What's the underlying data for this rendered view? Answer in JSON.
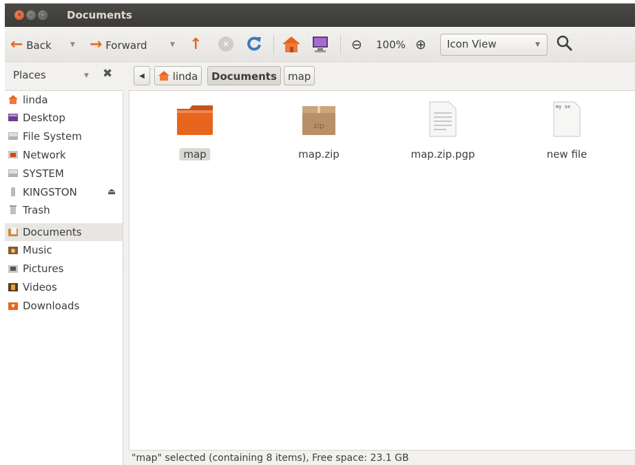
{
  "window": {
    "title": "Documents"
  },
  "toolbar": {
    "back_label": "Back",
    "forward_label": "Forward",
    "zoom_level": "100%",
    "view_mode": "Icon View"
  },
  "places": {
    "label": "Places"
  },
  "breadcrumb": [
    {
      "label": "linda"
    },
    {
      "label": "Documents"
    },
    {
      "label": "map"
    }
  ],
  "sidebar": {
    "items": [
      {
        "label": "linda",
        "icon": "home-folder-icon"
      },
      {
        "label": "Desktop",
        "icon": "desktop-icon"
      },
      {
        "label": "File System",
        "icon": "drive-icon"
      },
      {
        "label": "Network",
        "icon": "network-icon"
      },
      {
        "label": "SYSTEM",
        "icon": "drive-icon"
      },
      {
        "label": "KINGSTON",
        "icon": "usb-drive-icon"
      },
      {
        "label": "Trash",
        "icon": "trash-icon"
      },
      {
        "label": "Documents",
        "icon": "documents-folder-icon"
      },
      {
        "label": "Music",
        "icon": "music-folder-icon"
      },
      {
        "label": "Pictures",
        "icon": "pictures-folder-icon"
      },
      {
        "label": "Videos",
        "icon": "videos-folder-icon"
      },
      {
        "label": "Downloads",
        "icon": "downloads-folder-icon"
      }
    ]
  },
  "files": [
    {
      "name": "map",
      "icon": "folder-icon",
      "selected": true
    },
    {
      "name": "map.zip",
      "icon": "archive-icon"
    },
    {
      "name": "map.zip.pgp",
      "icon": "text-file-icon"
    },
    {
      "name": "new file",
      "icon": "text-file-icon",
      "thumb_text": "my se"
    }
  ],
  "status": {
    "text": "\"map\" selected (containing 8 items), Free space: 23.1 GB"
  },
  "colors": {
    "accent": "#e8651d",
    "titlebar": "#3c3b37",
    "selection": "#e7e6e3"
  }
}
